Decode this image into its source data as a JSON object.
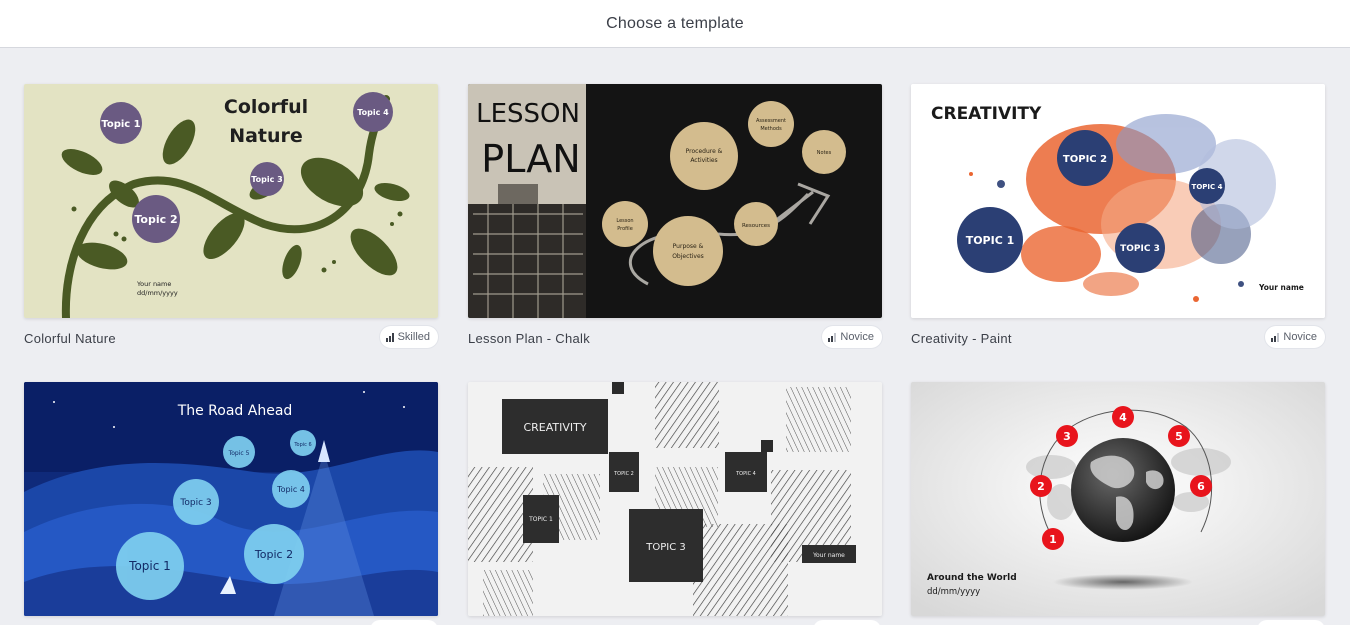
{
  "header": {
    "title": "Choose a template"
  },
  "templates": [
    {
      "name": "Colorful Nature",
      "level": "Skilled",
      "slide": {
        "title_line1": "Colorful",
        "title_line2": "Nature",
        "topics": [
          "Topic 1",
          "Topic 2",
          "Topic 3",
          "Topic 4"
        ],
        "author": "Your name",
        "date": "dd/mm/yyyy"
      }
    },
    {
      "name": "Lesson Plan - Chalk",
      "level": "Novice",
      "slide": {
        "title_line1": "LESSON",
        "title_line2": "PLAN",
        "nodes": [
          "Procedure &",
          "Activities",
          "Assessment",
          "Methods",
          "Notes",
          "Lesson",
          "Profile",
          "Resources",
          "Purpose &",
          "Objectives"
        ]
      }
    },
    {
      "name": "Creativity - Paint",
      "level": "Novice",
      "slide": {
        "title": "CREATIVITY",
        "topics": [
          "TOPIC 1",
          "TOPIC 2",
          "TOPIC 3",
          "TOPIC 4"
        ],
        "author": "Your name"
      }
    },
    {
      "name": "",
      "level": "",
      "slide": {
        "title": "The Road Ahead",
        "topics": [
          "Topic 1",
          "Topic 2",
          "Topic 3",
          "Topic 4",
          "Topic 5",
          "Topic 6"
        ]
      }
    },
    {
      "name": "",
      "level": "",
      "slide": {
        "title": "CREATIVITY",
        "topics": [
          "TOPIC 1",
          "TOPIC 2",
          "TOPIC 3",
          "TOPIC 4"
        ],
        "author": "Your name"
      }
    },
    {
      "name": "",
      "level": "",
      "slide": {
        "title": "Around the World",
        "date": "dd/mm/yyyy",
        "steps": [
          "1",
          "2",
          "3",
          "4",
          "5",
          "6"
        ]
      }
    }
  ],
  "colors": {
    "accent_red": "#e8141c",
    "nature_bg": "#e3e3c3",
    "leaf": "#4a5a24",
    "topic_purple": "#6a5a82",
    "chalk_bg": "#141414",
    "chalk_node": "#d3bc8e",
    "paint_blue": "#2b3f74",
    "paint_orange": "#e8561c",
    "road_bg": "#0f2a7a",
    "road_bubble": "#7fd0f0"
  },
  "icons": {
    "level": "signal-bars-icon"
  }
}
